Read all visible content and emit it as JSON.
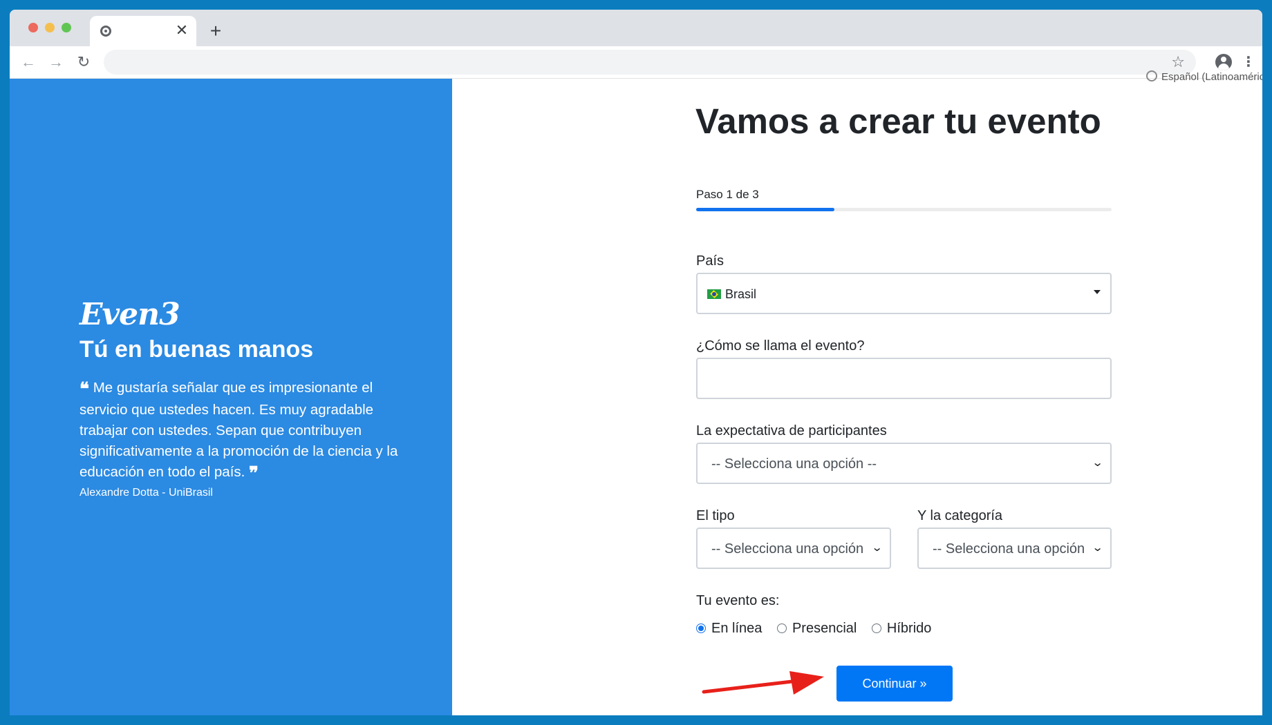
{
  "browser": {
    "tab_close_glyph": "✕",
    "new_tab_glyph": "+",
    "back_glyph": "←",
    "forward_glyph": "→",
    "reload_glyph": "↻",
    "star_glyph": "☆",
    "menu_glyph": "⋮",
    "omnibox_value": ""
  },
  "left": {
    "logo": "Even3",
    "tagline": "Tú en buenas manos",
    "quote_open": "❝",
    "quote": "Me gustaría señalar que es impresionante el servicio que ustedes hacen. Es muy agradable trabajar con ustedes. Sepan que contribuyen significativamente a la promoción de la ciencia y la educación en todo el país.",
    "quote_close": "❞",
    "author": "Alexandre Dotta - UniBrasil"
  },
  "right": {
    "language": "Español (Latinoamérica)",
    "title": "Vamos a crear tu evento",
    "step_label": "Paso 1 de 3",
    "progress_fraction": 0.333,
    "country": {
      "label": "País",
      "value": "Brasil"
    },
    "event_name": {
      "label": "¿Cómo se llama el evento?",
      "value": ""
    },
    "participants": {
      "label": "La expectativa de participantes",
      "value": "-- Selecciona una opción --"
    },
    "type": {
      "label": "El tipo",
      "value": "-- Selecciona una opción"
    },
    "category": {
      "label": "Y la categoría",
      "value": "-- Selecciona una opción"
    },
    "event_mode": {
      "label": "Tu evento es:",
      "options": [
        "En línea",
        "Presencial",
        "Híbrido"
      ],
      "selected": "En línea"
    },
    "continue_label": "Continuar",
    "continue_icon": "»"
  },
  "colors": {
    "left_panel": "#2b8ae2",
    "accent": "#0277f6",
    "progress": "#1172ee",
    "annotation_arrow": "#e8201a",
    "frame": "#0b7dbf"
  }
}
